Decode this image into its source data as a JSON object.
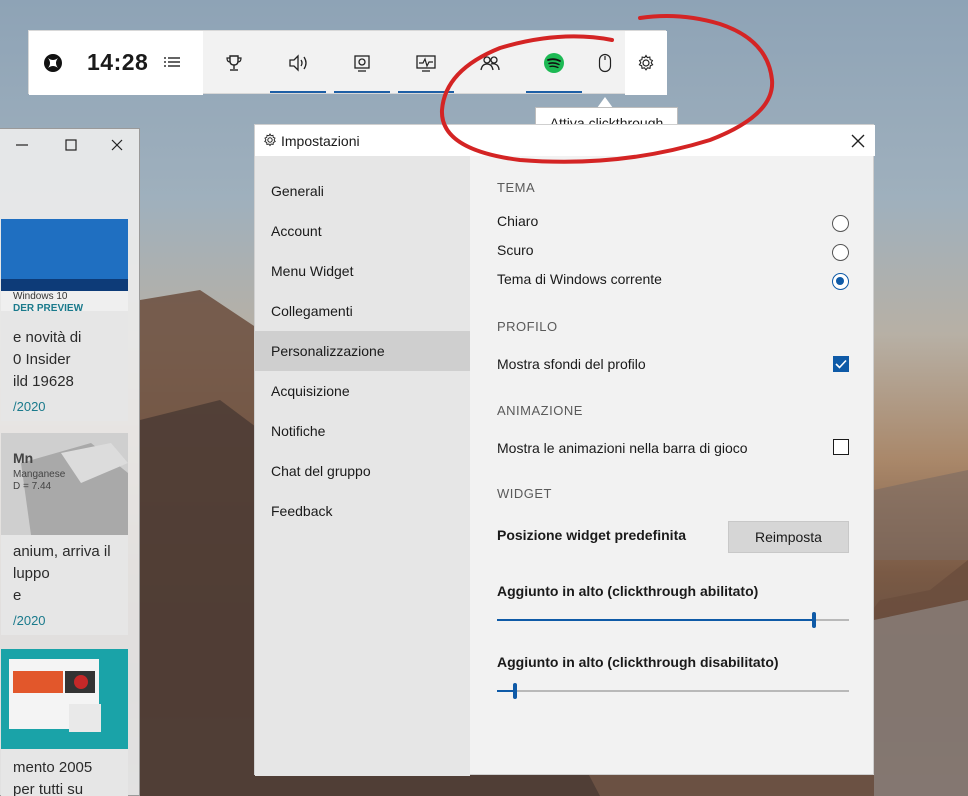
{
  "gamebar": {
    "time": "14:28",
    "buttons": [
      {
        "name": "achievements-button",
        "icon": "trophy-icon",
        "underline": false
      },
      {
        "name": "audio-button",
        "icon": "speaker-icon",
        "underline": true
      },
      {
        "name": "capture-button",
        "icon": "capture-icon",
        "underline": true
      },
      {
        "name": "performance-button",
        "icon": "performance-icon",
        "underline": true
      },
      {
        "name": "xbox-social-button",
        "icon": "people-icon",
        "underline": false
      },
      {
        "name": "spotify-button",
        "icon": "spotify-icon",
        "underline": true
      },
      {
        "name": "clickthrough-button",
        "icon": "mouse-icon",
        "underline": false
      }
    ],
    "accent_color": "#1d5fa6"
  },
  "tooltip": {
    "text": "Attiva clickthrough"
  },
  "browser": {
    "cards": [
      {
        "image_caption_1": "Windows 10",
        "image_caption_2": "DER PREVIEW",
        "lines": [
          "e novità di",
          "0 Insider",
          "ild 19628"
        ],
        "date": "/2020"
      },
      {
        "image_caption_1": "Mn",
        "image_caption_2": "Manganese",
        "image_caption_3": "D = 7.44",
        "lines": [
          "anium, arriva il",
          "luppo",
          "e"
        ],
        "date": "/2020"
      },
      {
        "lines": [
          "mento 2005",
          "per tutti su"
        ]
      }
    ]
  },
  "settings": {
    "title": "Impostazioni",
    "nav": [
      {
        "label": "Generali",
        "active": false
      },
      {
        "label": "Account",
        "active": false
      },
      {
        "label": "Menu Widget",
        "active": false
      },
      {
        "label": "Collegamenti",
        "active": false
      },
      {
        "label": "Personalizzazione",
        "active": true
      },
      {
        "label": "Acquisizione",
        "active": false
      },
      {
        "label": "Notifiche",
        "active": false
      },
      {
        "label": "Chat del gruppo",
        "active": false
      },
      {
        "label": "Feedback",
        "active": false
      }
    ],
    "tema": {
      "header": "TEMA",
      "options": [
        {
          "label": "Chiaro",
          "selected": false
        },
        {
          "label": "Scuro",
          "selected": false
        },
        {
          "label": "Tema di Windows corrente",
          "selected": true
        }
      ]
    },
    "profilo": {
      "header": "PROFILO",
      "show_backgrounds_label": "Mostra sfondi del profilo",
      "show_backgrounds_checked": true
    },
    "animazione": {
      "header": "ANIMAZIONE",
      "show_animations_label": "Mostra le animazioni nella barra di gioco",
      "show_animations_checked": false
    },
    "widget": {
      "header": "WIDGET",
      "default_position_label": "Posizione widget predefinita",
      "reset_label": "Reimposta",
      "slider1_label": "Aggiunto in alto (clickthrough abilitato)",
      "slider1_value": 0.9,
      "slider2_label": "Aggiunto in alto (clickthrough disabilitato)",
      "slider2_value": 0.05
    },
    "accent_color": "#0e5aa7"
  },
  "annotation": {
    "color": "#d42424"
  }
}
